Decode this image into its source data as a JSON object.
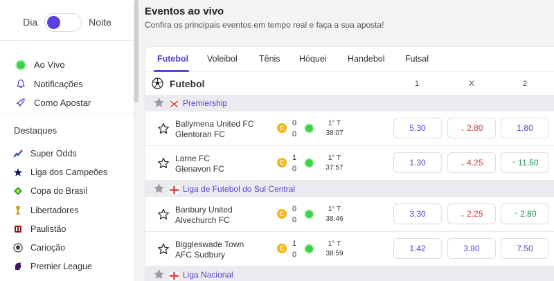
{
  "theme": {
    "day_label": "Dia",
    "night_label": "Noite"
  },
  "nav": [
    {
      "label": "Ao Vivo",
      "icon": "live-dot-icon"
    },
    {
      "label": "Notificações",
      "icon": "bell-icon"
    },
    {
      "label": "Como Apostar",
      "icon": "rocket-icon"
    }
  ],
  "highlights_title": "Destaques",
  "highlights": [
    {
      "label": "Super Odds",
      "icon": "super-odds-icon"
    },
    {
      "label": "Liga dos Campeões",
      "icon": "champions-league-icon"
    },
    {
      "label": "Copa do Brasil",
      "icon": "copa-do-brasil-icon"
    },
    {
      "label": "Libertadores",
      "icon": "libertadores-icon"
    },
    {
      "label": "Paulistão",
      "icon": "paulistao-icon"
    },
    {
      "label": "Carioção",
      "icon": "cariocao-icon"
    },
    {
      "label": "Premier League",
      "icon": "premier-league-icon"
    }
  ],
  "main": {
    "title": "Eventos ao vivo",
    "subtitle": "Confira os principais eventos em tempo real e faça a sua aposta!"
  },
  "tabs": [
    "Futebol",
    "Voleibol",
    "Tênis",
    "Hóquei",
    "Handebol",
    "Futsal"
  ],
  "sport": {
    "name": "Futebol",
    "col_1": "1",
    "col_x": "X",
    "col_2": "2"
  },
  "leagues": [
    {
      "name": "Premiership",
      "flag": "northern-ireland-flag",
      "matches": [
        {
          "home": "Ballymena United FC",
          "away": "Glentoran FC",
          "home_score": "0",
          "away_score": "0",
          "period": "1° T",
          "clock": "38:07",
          "odd_1": "5.30",
          "odd_x": "2.80",
          "odd_2": "1.80",
          "trend_1": "",
          "trend_x": "down",
          "trend_2": ""
        },
        {
          "home": "Larne FC",
          "away": "Glenavon FC",
          "home_score": "1",
          "away_score": "0",
          "period": "1° T",
          "clock": "37:57",
          "odd_1": "1.30",
          "odd_x": "4.25",
          "odd_2": "11.50",
          "trend_1": "",
          "trend_x": "down",
          "trend_2": "up"
        }
      ]
    },
    {
      "name": "Liga de Futebol do Sul Central",
      "flag": "england-flag",
      "matches": [
        {
          "home": "Banbury United",
          "away": "Alvechurch FC",
          "home_score": "0",
          "away_score": "0",
          "period": "1° T",
          "clock": "38:46",
          "odd_1": "3.30",
          "odd_x": "2.25",
          "odd_2": "2.80",
          "trend_1": "",
          "trend_x": "down",
          "trend_2": "up"
        },
        {
          "home": "Biggleswade Town",
          "away": "AFC Sudbury",
          "home_score": "1",
          "away_score": "0",
          "period": "1° T",
          "clock": "38:59",
          "odd_1": "1.42",
          "odd_x": "3.80",
          "odd_2": "7.50",
          "trend_1": "",
          "trend_x": "",
          "trend_2": ""
        }
      ]
    },
    {
      "name": "Liga Nacional",
      "flag": "england-flag",
      "matches": []
    }
  ],
  "colors": {
    "accent": "#5b3fe0",
    "live": "#3dd24a",
    "down": "#d93a3a",
    "up": "#1c8a4a",
    "coin": "#f4b619"
  }
}
